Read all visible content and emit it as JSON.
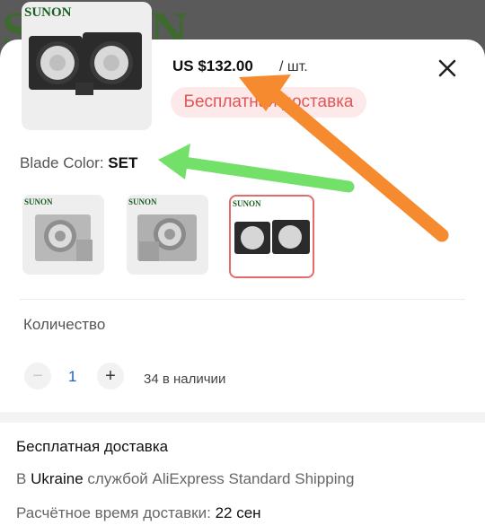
{
  "background": {
    "brand_text": "SUNON"
  },
  "product": {
    "brand": "SUNON",
    "price": "US $132.00",
    "unit": "/ шт.",
    "shipping_badge": "Бесплатная доставка"
  },
  "blade_color": {
    "label": "Blade Color:",
    "value": "SET"
  },
  "variants": [
    {
      "brand": "SUNON"
    },
    {
      "brand": "SUNON"
    },
    {
      "brand": "SUNON"
    }
  ],
  "quantity": {
    "label": "Количество",
    "minus": "−",
    "value": "1",
    "plus": "+",
    "stock": "34 в наличии"
  },
  "shipping": {
    "title": "Бесплатная доставка",
    "line_prefix": "В",
    "country": "Ukraine",
    "line_rest": "службой AliExpress Standard Shipping",
    "eta_label": "Расчётное время доставки:",
    "eta_value": "22 сен"
  },
  "colors": {
    "accent_red": "#e35555",
    "arrow_orange": "#f58b2e",
    "arrow_green": "#73e06a",
    "brand_green": "#1a5e20"
  }
}
